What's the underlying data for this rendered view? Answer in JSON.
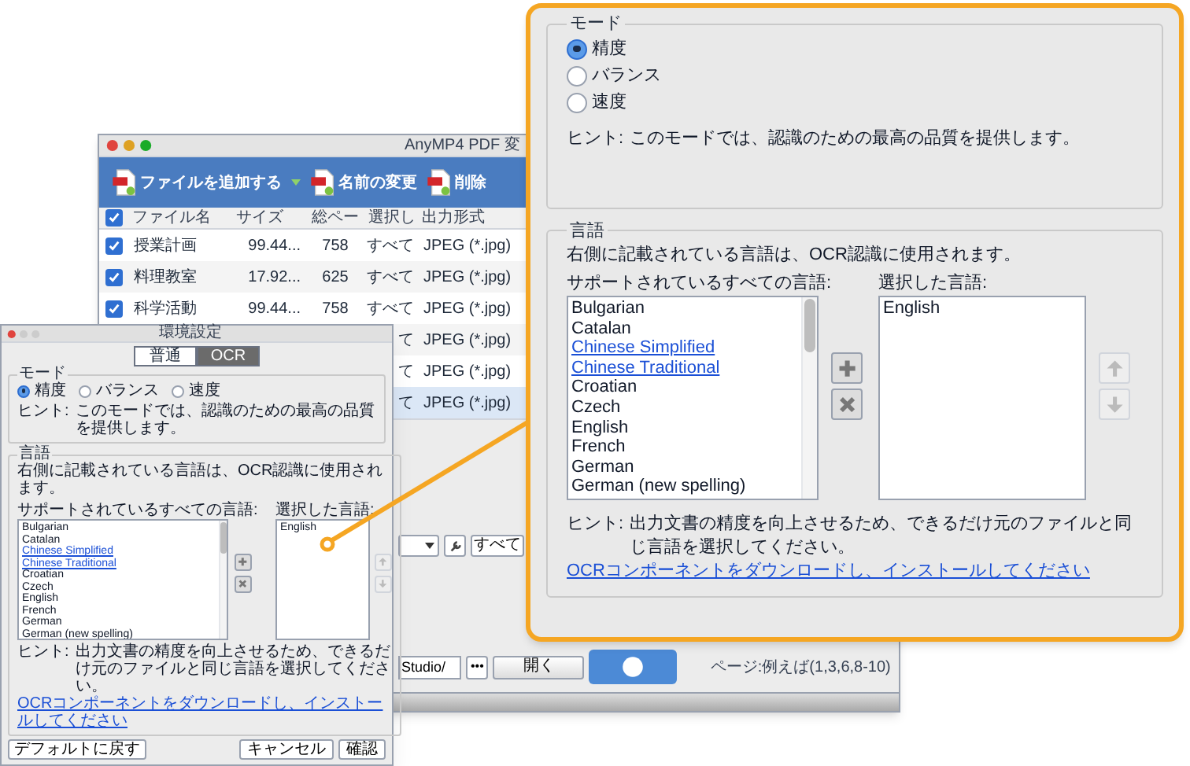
{
  "app_window": {
    "title": "AnyMP4 PDF 変",
    "toolbar": [
      {
        "label": "ファイルを追加する",
        "dropdown": true
      },
      {
        "label": "名前の変更",
        "dropdown": false
      },
      {
        "label": "削除",
        "dropdown": false
      }
    ],
    "table": {
      "header_checked": true,
      "columns": [
        "ファイル名",
        "サイズ",
        "総ペー",
        "選択し",
        "出力形式"
      ],
      "rows": [
        {
          "checked": true,
          "selected": false,
          "name": "授業計画",
          "size": "99.44...",
          "pages": "758",
          "selection": "すべて",
          "format": "JPEG (*.jpg)"
        },
        {
          "checked": true,
          "selected": false,
          "name": "料理教室",
          "size": "17.92...",
          "pages": "625",
          "selection": "すべて",
          "format": "JPEG (*.jpg)"
        },
        {
          "checked": true,
          "selected": false,
          "name": "科学活動",
          "size": "99.44...",
          "pages": "758",
          "selection": "すべて",
          "format": "JPEG (*.jpg)"
        },
        {
          "selected": false,
          "selection": "て",
          "format": "JPEG (*.jpg)"
        },
        {
          "selected": false,
          "selection": "て",
          "format": "JPEG (*.jpg)"
        },
        {
          "selected": true,
          "selection": "て",
          "format": "JPEG (*.jpg)"
        }
      ]
    },
    "all_button": "すべて",
    "path": "Studio/",
    "browse_button": "•••",
    "open_button": "開く",
    "pages_hint": "ページ:例えば(1,3,6,8-10)"
  },
  "settings_dialog": {
    "title": "環境設定",
    "tabs": [
      {
        "label": "普通",
        "selected": false
      },
      {
        "label": "OCR",
        "selected": true
      }
    ],
    "ocr": {
      "mode": {
        "legend": "モード",
        "options": [
          {
            "label": "精度",
            "selected": true
          },
          {
            "label": "バランス",
            "selected": false
          },
          {
            "label": "速度",
            "selected": false
          }
        ],
        "hint_label": "ヒント:",
        "hint": "このモードでは、認識のための最高の品質を提供します。"
      },
      "language": {
        "legend": "言語",
        "description": "右側に記載されている言語は、OCR認識に使用されます。",
        "available_label": "サポートされているすべての言語:",
        "available": [
          {
            "label": "Bulgarian",
            "link": false
          },
          {
            "label": "Catalan",
            "link": false
          },
          {
            "label": "Chinese Simplified",
            "link": true
          },
          {
            "label": "Chinese Traditional",
            "link": true
          },
          {
            "label": "Croatian",
            "link": false
          },
          {
            "label": "Czech",
            "link": false
          },
          {
            "label": "English",
            "link": false
          },
          {
            "label": "French",
            "link": false
          },
          {
            "label": "German",
            "link": false
          },
          {
            "label": "German (new spelling)",
            "link": false
          }
        ],
        "selected_label": "選択した言語:",
        "selected_languages": [
          "English"
        ],
        "hint_label": "ヒント:",
        "hint": "出力文書の精度を向上させるため、できるだけ元のファイルと同じ言語を選択してください。",
        "download_link": "OCRコンポーネントをダウンロードし、インストールしてください"
      }
    },
    "buttons_left": [
      "デフォルトに戻す"
    ],
    "buttons_right": [
      "キャンセル",
      "確認"
    ]
  },
  "zoom_panel": {
    "mode": {
      "legend": "モード",
      "options": [
        {
          "label": "精度",
          "selected": true
        },
        {
          "label": "バランス",
          "selected": false
        },
        {
          "label": "速度",
          "selected": false
        }
      ],
      "hint_label": "ヒント:",
      "hint": "このモードでは、認識のための最高の品質を提供します。"
    },
    "language": {
      "legend": "言語",
      "description": "右側に記載されている言語は、OCR認識に使用されます。",
      "available_label": "サポートされているすべての言語:",
      "available": [
        {
          "label": "Bulgarian",
          "link": false
        },
        {
          "label": "Catalan",
          "link": false
        },
        {
          "label": "Chinese Simplified",
          "link": true
        },
        {
          "label": "Chinese Traditional",
          "link": true
        },
        {
          "label": "Croatian",
          "link": false
        },
        {
          "label": "Czech",
          "link": false
        },
        {
          "label": "English",
          "link": false
        },
        {
          "label": "French",
          "link": false
        },
        {
          "label": "German",
          "link": false
        },
        {
          "label": "German (new spelling)",
          "link": false
        }
      ],
      "selected_label": "選択した言語:",
      "selected_languages": [
        "English"
      ],
      "hint_label": "ヒント:",
      "hint": "出力文書の精度を向上させるため、できるだけ元のファイルと同じ言語を選択してください。",
      "download_link": "OCRコンポーネントをダウンロードし、インストールしてください"
    }
  }
}
